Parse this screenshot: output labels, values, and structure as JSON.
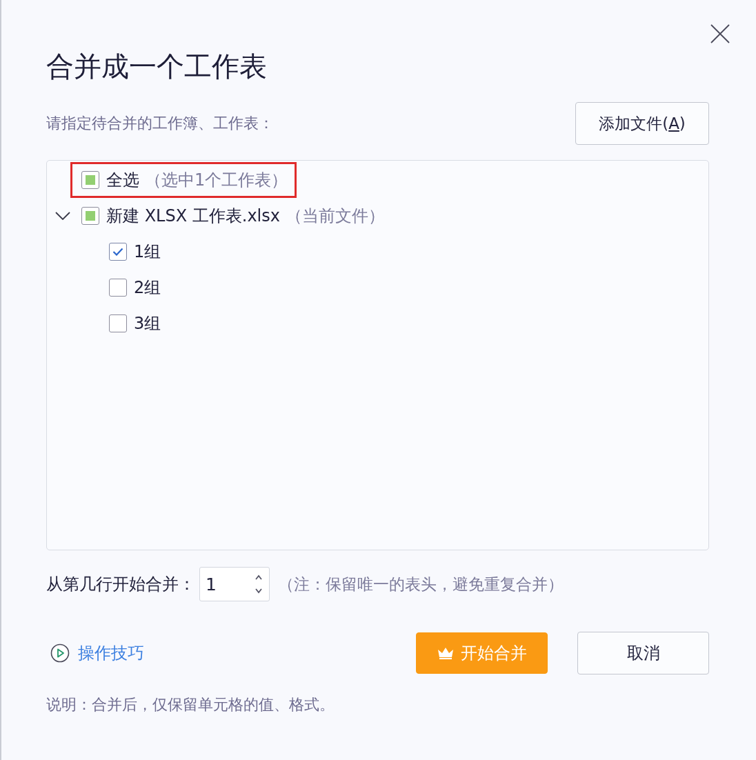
{
  "dialog": {
    "title": "合并成一个工作表",
    "prompt": "请指定待合并的工作簿、工作表：",
    "add_file_button": {
      "prefix": "添加文件(",
      "access_key": "A",
      "suffix": ")"
    }
  },
  "tree": {
    "select_all": {
      "label": "全选",
      "note": "（选中1个工作表）",
      "checked": false,
      "indeterminate": true,
      "highlighted": true
    },
    "files": [
      {
        "name": "新建 XLSX 工作表.xlsx",
        "note": "（当前文件）",
        "expanded": true,
        "checked": false,
        "indeterminate": true,
        "children": [
          {
            "name": "1组",
            "checked": true
          },
          {
            "name": "2组",
            "checked": false
          },
          {
            "name": "3组",
            "checked": false
          }
        ]
      }
    ]
  },
  "start_row": {
    "label": "从第几行开始合并：",
    "value": "1",
    "note": "（注：保留唯一的表头，避免重复合并）"
  },
  "tips_link": "操作技巧",
  "buttons": [
    {
      "label": "开始合并",
      "kind": "primary"
    },
    {
      "label": "取消",
      "kind": "secondary"
    }
  ],
  "footnote": "说明：合并后，仅保留单元格的值、格式。"
}
